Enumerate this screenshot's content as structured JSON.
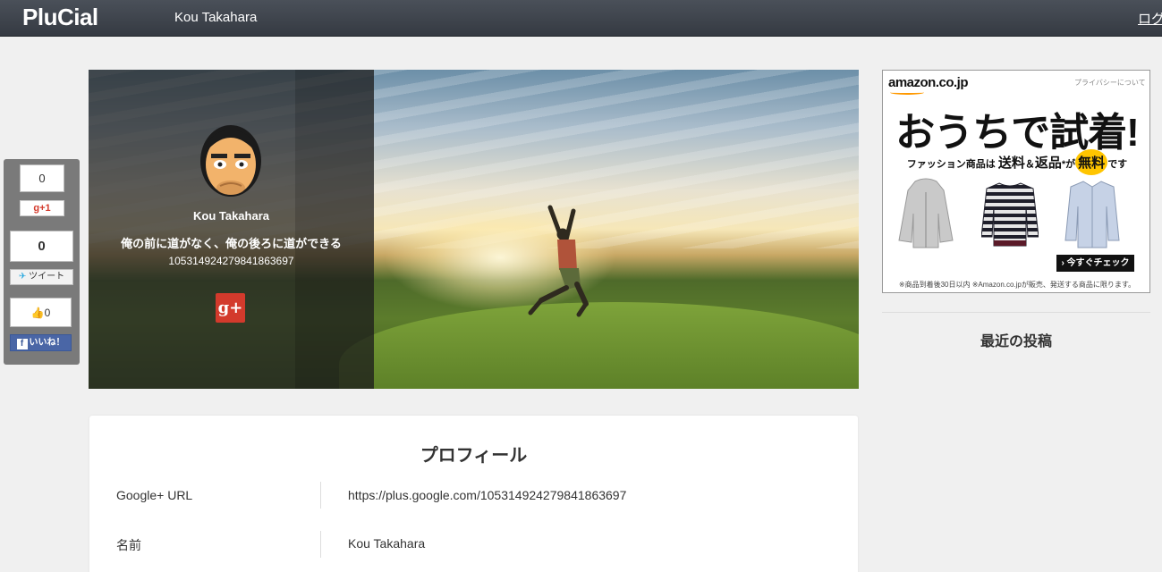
{
  "header": {
    "logo": "PluCial",
    "user_name": "Kou Takahara",
    "login": "ログイン"
  },
  "cover": {
    "name": "Kou Takahara",
    "tagline": "俺の前に道がなく、俺の後ろに道ができる",
    "id": "105314924279841863697",
    "gplus_label": "g+"
  },
  "social": {
    "gplus_count": "0",
    "gplus_button": "+1",
    "tweet_count": "0",
    "tweet_button": "ツイート",
    "like_count": "0",
    "like_button": "いいね！"
  },
  "profile": {
    "title": "プロフィール",
    "rows": [
      {
        "label": "Google+ URL",
        "value": "https://plus.google.com/105314924279841863697"
      },
      {
        "label": "名前",
        "value": "Kou Takahara"
      }
    ]
  },
  "ad": {
    "logo": "amazon.co.jp",
    "privacy": "プライバシーについて",
    "headline": "おうちで試着!",
    "sub_prefix": "ファッション商品は",
    "sub_shipping": "送料",
    "sub_amp": "＆",
    "sub_returns": "返品",
    "sub_star": "*",
    "sub_ga": "が",
    "sub_free": "無料",
    "sub_desu": "です",
    "cta": "› 今すぐチェック",
    "note": "※商品到着後30日以内 ※Amazon.co.jpが販売、発送する商品に限ります。"
  },
  "sidebar": {
    "recent_posts": "最近の投稿"
  },
  "colors": {
    "topbar": "#3f444c",
    "gplus_red": "#d33a2c",
    "facebook_blue": "#4a66a6",
    "twitter_blue": "#2aa9e0",
    "amazon_orange": "#ff9900",
    "free_badge_yellow": "#ffc500"
  }
}
